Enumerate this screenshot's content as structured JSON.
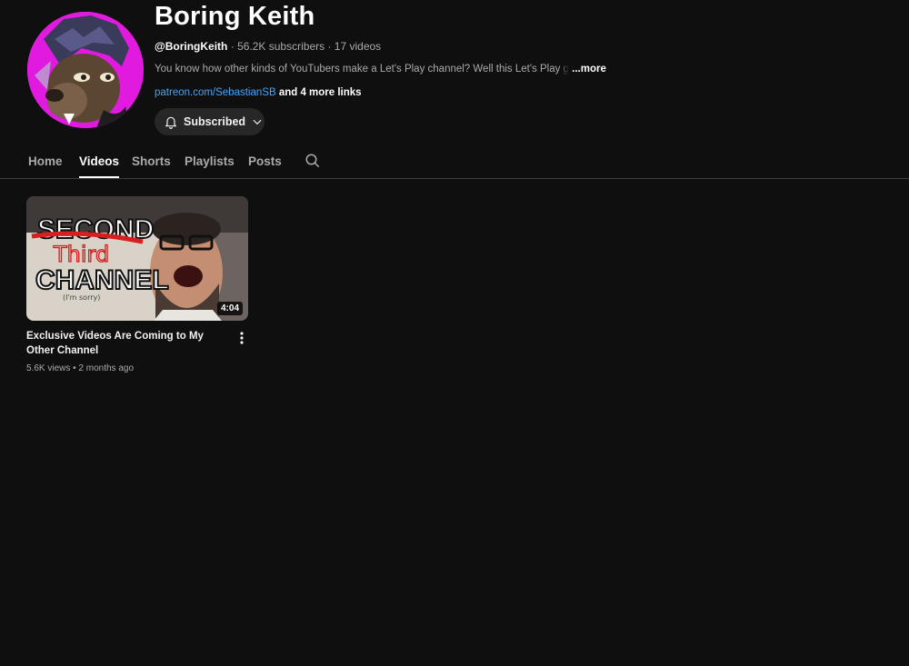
{
  "channel": {
    "name": "Boring Keith",
    "handle": "@BoringKeith",
    "subscribers": "56.2K subscribers",
    "video_count": "17 videos",
    "description": "You know how other kinds of YouTubers make a Let's Play channel? Well this Let's Play",
    "description_fade": " g",
    "more_label": "...more",
    "link": "patreon.com/SebastianSB",
    "more_links": "and 4 more links",
    "subscribed_label": "Subscribed"
  },
  "tabs": [
    {
      "label": "Home"
    },
    {
      "label": "Videos",
      "active": true
    },
    {
      "label": "Shorts"
    },
    {
      "label": "Playlists"
    },
    {
      "label": "Posts"
    }
  ],
  "videos": [
    {
      "title": "Exclusive Videos Are Coming to My Other Channel",
      "views": "5.6K views",
      "age": "2 months ago",
      "duration": "4:04",
      "thumb_text": {
        "line1": "SECOND",
        "line2": "Third",
        "line3": "CHANNEL",
        "small": "(I'm sorry)"
      }
    }
  ],
  "colors": {
    "background": "#0f0f0f",
    "link": "#3ea6ff",
    "avatar_bg": "#e01adf"
  },
  "icons": {
    "bell": "bell-icon",
    "chevron": "chevron-down-icon",
    "search": "search-icon",
    "kebab": "more-vert-icon"
  }
}
